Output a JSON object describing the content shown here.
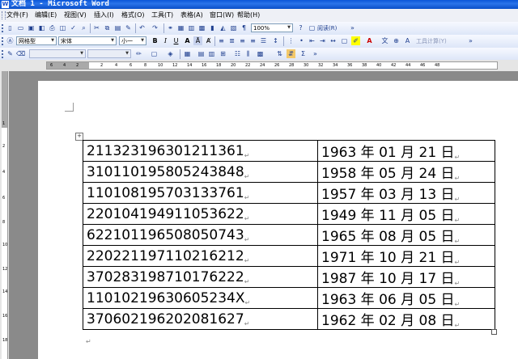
{
  "window": {
    "title": "文档 1 - Microsoft Word"
  },
  "menu": [
    "文件(F)",
    "编辑(E)",
    "视图(V)",
    "插入(I)",
    "格式(O)",
    "工具(T)",
    "表格(A)",
    "窗口(W)",
    "帮助(H)"
  ],
  "toolbar": {
    "zoom": "100%",
    "read_label": "阅读(R)",
    "style": "网格型",
    "font": "宋体",
    "size": "小一",
    "bold": "B",
    "italic": "I",
    "underline": "U",
    "grow_font": "A",
    "tools_label": "工具计算(Y)"
  },
  "ruler": {
    "ticks": [
      "6",
      "4",
      "2",
      "2",
      "4",
      "6",
      "8",
      "10",
      "12",
      "14",
      "16",
      "18",
      "20",
      "22",
      "24",
      "26",
      "28",
      "30",
      "32",
      "34",
      "36",
      "38",
      "40",
      "42",
      "44",
      "46",
      "48"
    ]
  },
  "vruler": {
    "ticks": [
      "1",
      "2",
      "4",
      "6",
      "8",
      "10",
      "12",
      "14",
      "16",
      "18"
    ]
  },
  "table": {
    "rows": [
      {
        "id": "211323196301211361",
        "date": "1963 年 01 月 21 日"
      },
      {
        "id": "310110195805243848",
        "date": "1958 年 05 月 24 日"
      },
      {
        "id": "110108195703133761",
        "date": "1957 年 03 月 13 日"
      },
      {
        "id": "220104194911053622",
        "date": "1949 年 11 月 05 日"
      },
      {
        "id": "622101196508050743",
        "date": "1965 年 08 月 05 日"
      },
      {
        "id": "220221197110216212",
        "date": "1971 年 10 月 21 日"
      },
      {
        "id": "370283198710176222",
        "date": "1987 年 10 月 17 日"
      },
      {
        "id": "11010219630605234X",
        "date": "1963 年 06 月 05 日"
      },
      {
        "id": "370602196202081627",
        "date": "1962 年 02 月 08 日"
      }
    ]
  }
}
